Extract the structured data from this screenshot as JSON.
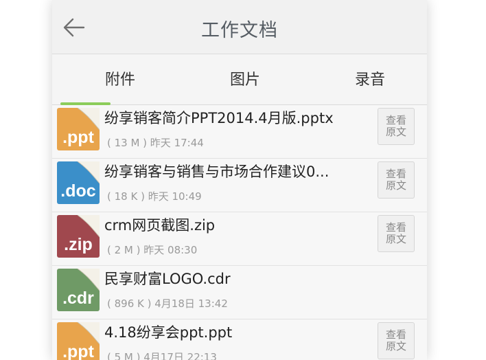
{
  "header": {
    "title": "工作文档"
  },
  "tabs": [
    {
      "label": "附件",
      "active": true
    },
    {
      "label": "图片",
      "active": false
    },
    {
      "label": "录音",
      "active": false
    }
  ],
  "colors": {
    "accent": "#8ccc5a",
    "ppt": "#e8a44c",
    "doc": "#3b8fc9",
    "zip": "#a0484e",
    "cdr": "#6f9a66"
  },
  "files": [
    {
      "ext": ".ppt",
      "icon": "ppt-file-icon",
      "name": "纷享销客简介PPT2014.4月版.pptx",
      "meta": "( 13 M ) 昨天 17:44",
      "view_l1": "查看",
      "view_l2": "原文",
      "has_view": true
    },
    {
      "ext": ".doc",
      "icon": "doc-file-icon",
      "name": "纷享销客与销售与市场合作建议0...",
      "meta": "( 18 K ) 昨天 10:49",
      "view_l1": "查看",
      "view_l2": "原文",
      "has_view": true
    },
    {
      "ext": ".zip",
      "icon": "zip-file-icon",
      "name": "crm网页截图.zip",
      "meta": "( 2 M ) 昨天 08:30",
      "view_l1": "查看",
      "view_l2": "原文",
      "has_view": true
    },
    {
      "ext": ".cdr",
      "icon": "cdr-file-icon",
      "name": "民享财富LOGO.cdr",
      "meta": "( 896 K ) 4月18日 13:42",
      "view_l1": "",
      "view_l2": "",
      "has_view": false
    },
    {
      "ext": ".ppt",
      "icon": "ppt-file-icon",
      "name": "4.18纷享会ppt.ppt",
      "meta": "( 5 M ) 4月17日 22:13",
      "view_l1": "查看",
      "view_l2": "原文",
      "has_view": true
    }
  ]
}
